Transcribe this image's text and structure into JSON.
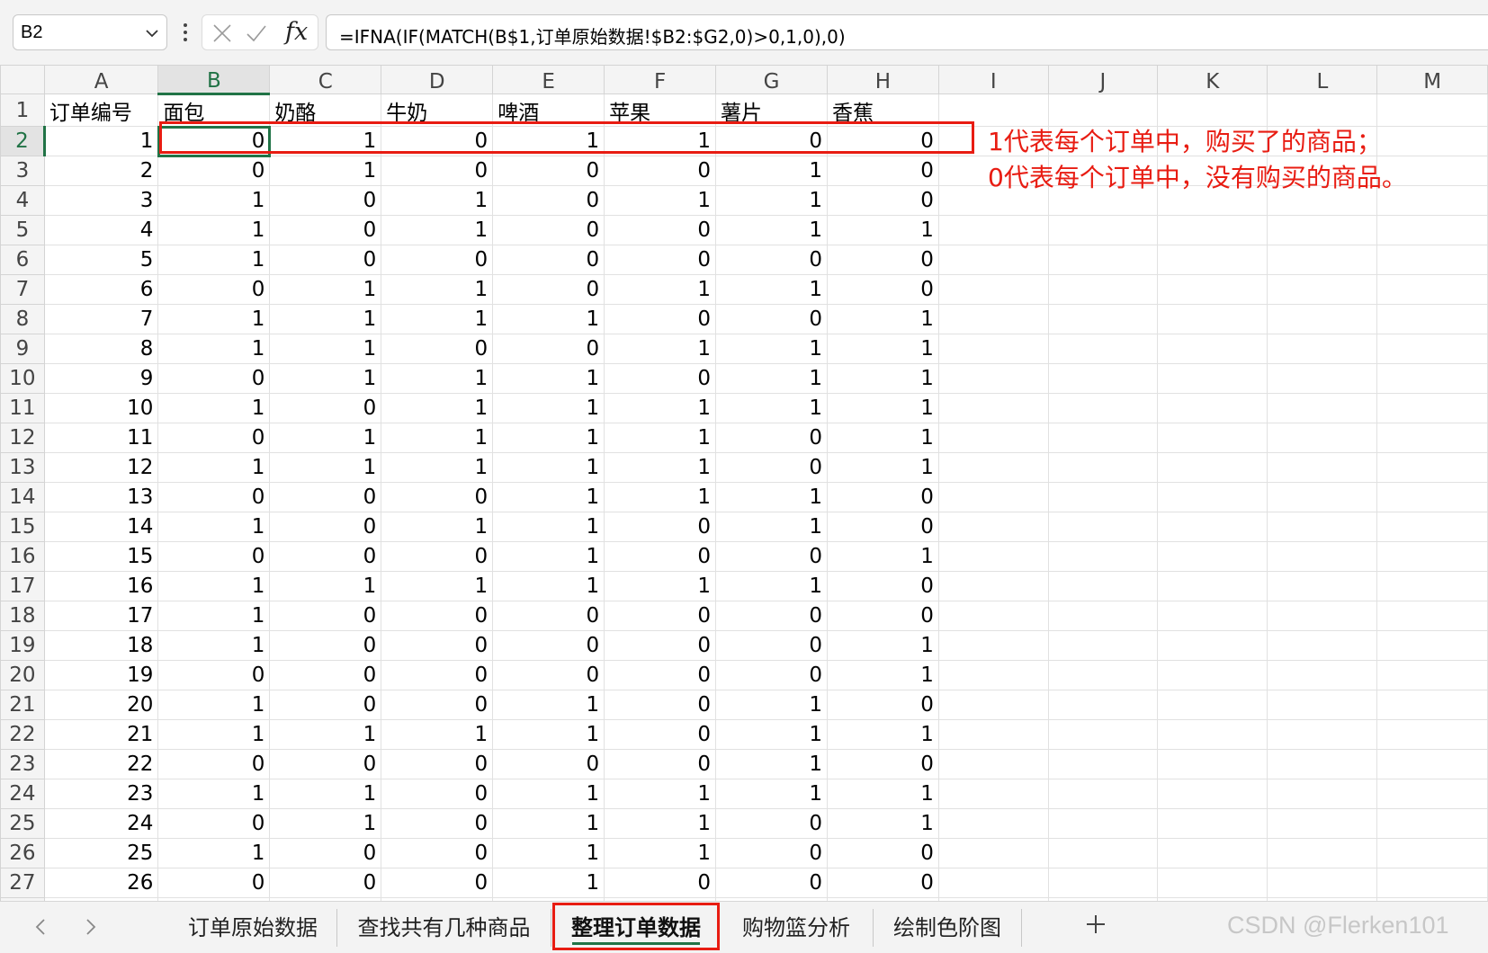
{
  "formula_bar": {
    "name_box": "B2",
    "fx_label": "fx",
    "formula": "=IFNA(IF(MATCH(B$1,订单原始数据!$B2:$G2,0)>0,1,0),0)"
  },
  "columns": [
    "A",
    "B",
    "C",
    "D",
    "E",
    "F",
    "G",
    "H",
    "I",
    "J",
    "K",
    "L",
    "M"
  ],
  "header_row": [
    "订单编号",
    "面包",
    "奶酪",
    "牛奶",
    "啤酒",
    "苹果",
    "薯片",
    "香蕉"
  ],
  "rows": [
    [
      1,
      0,
      1,
      0,
      1,
      1,
      0,
      0
    ],
    [
      2,
      0,
      1,
      0,
      0,
      0,
      1,
      0
    ],
    [
      3,
      1,
      0,
      1,
      0,
      1,
      1,
      0
    ],
    [
      4,
      1,
      0,
      1,
      0,
      0,
      1,
      1
    ],
    [
      5,
      1,
      0,
      0,
      0,
      0,
      0,
      0
    ],
    [
      6,
      0,
      1,
      1,
      0,
      1,
      1,
      0
    ],
    [
      7,
      1,
      1,
      1,
      1,
      0,
      0,
      1
    ],
    [
      8,
      1,
      1,
      0,
      0,
      1,
      1,
      1
    ],
    [
      9,
      0,
      1,
      1,
      1,
      0,
      1,
      1
    ],
    [
      10,
      1,
      0,
      1,
      1,
      1,
      1,
      1
    ],
    [
      11,
      0,
      1,
      1,
      1,
      1,
      0,
      1
    ],
    [
      12,
      1,
      1,
      1,
      1,
      1,
      0,
      1
    ],
    [
      13,
      0,
      0,
      0,
      1,
      1,
      1,
      0
    ],
    [
      14,
      1,
      0,
      1,
      1,
      0,
      1,
      0
    ],
    [
      15,
      0,
      0,
      0,
      1,
      0,
      0,
      1
    ],
    [
      16,
      1,
      1,
      1,
      1,
      1,
      1,
      0
    ],
    [
      17,
      1,
      0,
      0,
      0,
      0,
      0,
      0
    ],
    [
      18,
      1,
      0,
      0,
      0,
      0,
      0,
      1
    ],
    [
      19,
      0,
      0,
      0,
      0,
      0,
      0,
      1
    ],
    [
      20,
      1,
      0,
      0,
      1,
      0,
      1,
      0
    ],
    [
      21,
      1,
      1,
      1,
      1,
      0,
      1,
      1
    ],
    [
      22,
      0,
      0,
      0,
      0,
      0,
      1,
      0
    ],
    [
      23,
      1,
      1,
      0,
      1,
      1,
      1,
      1
    ],
    [
      24,
      0,
      1,
      0,
      1,
      1,
      0,
      1
    ],
    [
      25,
      1,
      0,
      0,
      1,
      1,
      0,
      0
    ],
    [
      26,
      0,
      0,
      0,
      1,
      0,
      0,
      0
    ]
  ],
  "active_cell": "B2",
  "annotation": {
    "line1": "1代表每个订单中，购买了的商品；",
    "line2": "0代表每个订单中，没有购买的商品。",
    "color": "#e81c12"
  },
  "sheet_tabs": [
    "订单原始数据",
    "查找共有几种商品",
    "整理订单数据",
    "购物篮分析",
    "绘制色阶图"
  ],
  "active_sheet": "整理订单数据",
  "watermark": "CSDN @Flerken101",
  "accent_color": "#217346",
  "icons": {
    "name_box_dropdown": "chevron-down-icon",
    "formula_menu": "more-vertical-icon",
    "cancel": "close-icon",
    "enter": "check-icon",
    "function": "fx-icon",
    "tab_prev": "chevron-left-icon",
    "tab_next": "chevron-right-icon",
    "add_sheet": "plus-icon"
  }
}
